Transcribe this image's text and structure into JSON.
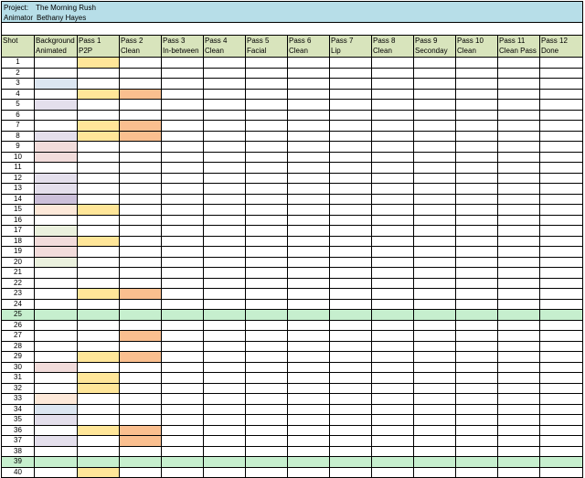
{
  "project": {
    "label": "Project:",
    "name": "The Morning Rush",
    "animator_label": "Animator",
    "animator": "Bethany Hayes"
  },
  "columns": [
    {
      "line1": "Shot",
      "line2": ""
    },
    {
      "line1": "Background",
      "line2": "Animated"
    },
    {
      "line1": "Pass 1",
      "line2": "P2P"
    },
    {
      "line1": "Pass 2",
      "line2": "Clean"
    },
    {
      "line1": "Pass 3",
      "line2": "In-between"
    },
    {
      "line1": "Pass 4",
      "line2": "Clean"
    },
    {
      "line1": "Pass 5",
      "line2": "Facial"
    },
    {
      "line1": "Pass 6",
      "line2": "Clean"
    },
    {
      "line1": "Pass 7",
      "line2": "Lip"
    },
    {
      "line1": "Pass 8",
      "line2": "Clean"
    },
    {
      "line1": "Pass 9",
      "line2": "Seconday"
    },
    {
      "line1": "Pass 10",
      "line2": "Clean"
    },
    {
      "line1": "Pass 11",
      "line2": "Clean Pass"
    },
    {
      "line1": "Pass 12",
      "line2": "Done"
    }
  ],
  "colors": {
    "title_band": "#b7dee8",
    "header_row": "#d8e4bc",
    "green_row": "#c6efce",
    "pass1_fill": "#ffe699",
    "pass2_fill": "#fabf8f",
    "bg_blue": "#dce6f1",
    "bg_lavender": "#e4dfec",
    "bg_purple": "#ccc0da",
    "bg_pink": "#f2dcdb",
    "bg_peach": "#fde9d9",
    "bg_sage": "#ebf1de"
  },
  "rows": [
    {
      "shot": "1",
      "bg": "",
      "p1": true,
      "p2": false
    },
    {
      "shot": "2",
      "bg": "",
      "p1": false,
      "p2": false
    },
    {
      "shot": "3",
      "bg": "blue",
      "p1": false,
      "p2": false
    },
    {
      "shot": "4",
      "bg": "",
      "p1": true,
      "p2": true
    },
    {
      "shot": "5",
      "bg": "lav",
      "p1": false,
      "p2": false
    },
    {
      "shot": "6",
      "bg": "",
      "p1": false,
      "p2": false
    },
    {
      "shot": "7",
      "bg": "",
      "p1": true,
      "p2": true
    },
    {
      "shot": "8",
      "bg": "lav",
      "p1": true,
      "p2": true
    },
    {
      "shot": "9",
      "bg": "pink",
      "p1": false,
      "p2": false
    },
    {
      "shot": "10",
      "bg": "pink",
      "p1": false,
      "p2": false
    },
    {
      "shot": "11",
      "bg": "",
      "p1": false,
      "p2": false
    },
    {
      "shot": "12",
      "bg": "lav",
      "p1": false,
      "p2": false
    },
    {
      "shot": "13",
      "bg": "lav",
      "p1": false,
      "p2": false
    },
    {
      "shot": "14",
      "bg": "purple",
      "p1": false,
      "p2": false
    },
    {
      "shot": "15",
      "bg": "peach",
      "p1": true,
      "p2": false
    },
    {
      "shot": "16",
      "bg": "",
      "p1": false,
      "p2": false
    },
    {
      "shot": "17",
      "bg": "sage",
      "p1": false,
      "p2": false
    },
    {
      "shot": "18",
      "bg": "pink",
      "p1": true,
      "p2": false
    },
    {
      "shot": "19",
      "bg": "pink",
      "p1": false,
      "p2": false
    },
    {
      "shot": "20",
      "bg": "sage",
      "p1": false,
      "p2": false
    },
    {
      "shot": "21",
      "bg": "",
      "p1": false,
      "p2": false
    },
    {
      "shot": "22",
      "bg": "",
      "p1": false,
      "p2": false
    },
    {
      "shot": "23",
      "bg": "",
      "p1": true,
      "p2": true
    },
    {
      "shot": "24",
      "bg": "",
      "p1": false,
      "p2": false
    },
    {
      "shot": "25",
      "bg": "",
      "p1": false,
      "p2": false,
      "green": true
    },
    {
      "shot": "26",
      "bg": "",
      "p1": false,
      "p2": false
    },
    {
      "shot": "27",
      "bg": "",
      "p1": false,
      "p2": true
    },
    {
      "shot": "28",
      "bg": "",
      "p1": false,
      "p2": false
    },
    {
      "shot": "29",
      "bg": "",
      "p1": true,
      "p2": true
    },
    {
      "shot": "30",
      "bg": "pink",
      "p1": false,
      "p2": false
    },
    {
      "shot": "31",
      "bg": "",
      "p1": true,
      "p2": false
    },
    {
      "shot": "32",
      "bg": "",
      "p1": true,
      "p2": false
    },
    {
      "shot": "33",
      "bg": "peach",
      "p1": false,
      "p2": false
    },
    {
      "shot": "34",
      "bg": "blue",
      "p1": false,
      "p2": false
    },
    {
      "shot": "35",
      "bg": "lav",
      "p1": false,
      "p2": false
    },
    {
      "shot": "36",
      "bg": "",
      "p1": true,
      "p2": true
    },
    {
      "shot": "37",
      "bg": "lav",
      "p1": false,
      "p2": true
    },
    {
      "shot": "38",
      "bg": "",
      "p1": false,
      "p2": false
    },
    {
      "shot": "39",
      "bg": "",
      "p1": false,
      "p2": false,
      "green": true
    },
    {
      "shot": "40",
      "bg": "",
      "p1": true,
      "p2": false
    }
  ]
}
